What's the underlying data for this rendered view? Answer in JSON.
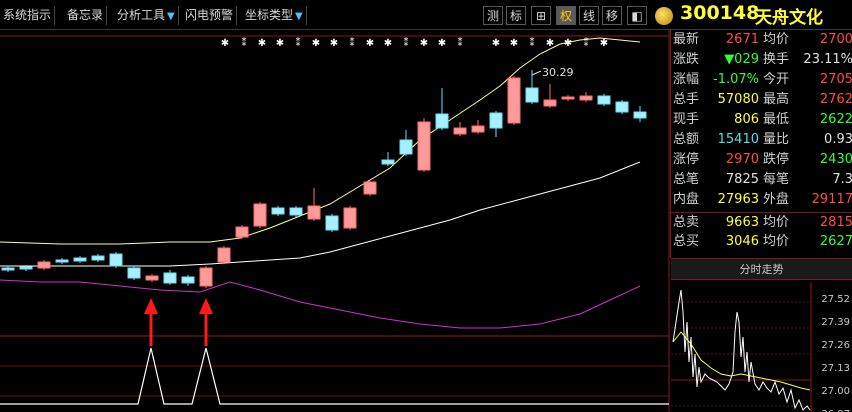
{
  "toolbar": {
    "items": [
      {
        "label": "系统指示",
        "arrow": false
      },
      {
        "label": "备忘录",
        "arrow": false
      },
      {
        "label": "分析工具",
        "arrow": true
      },
      {
        "label": "闪电预警",
        "arrow": false
      },
      {
        "label": "坐标类型",
        "arrow": true
      }
    ],
    "right_buttons": [
      {
        "label": "测",
        "active": false
      },
      {
        "label": "标",
        "active": false
      },
      {
        "label": "⊞",
        "active": false
      },
      {
        "label": "权",
        "active": true
      },
      {
        "label": "线",
        "active": false
      },
      {
        "label": "移",
        "active": false
      },
      {
        "label": "◧",
        "active": false
      }
    ],
    "stock_code": "300148",
    "stock_name": "天舟文化"
  },
  "chart": {
    "high_label": "30.29",
    "colors": {
      "up": "#ff6b6b",
      "down": "#66e0ff",
      "ma_short": "#ffff99",
      "ma_long": "#ffffff",
      "ma_indicator": "#cc33cc",
      "grid": "#8b1a1a",
      "arrow": "#ff1a1a"
    }
  },
  "quote": {
    "rows": [
      {
        "l1": "最新",
        "v1": "2671",
        "c1": "red",
        "l2": "均价",
        "v2": "2700",
        "c2": "red"
      },
      {
        "l1": "涨跌",
        "v1": "▼029",
        "c1": "green",
        "l2": "换手",
        "v2": "23.11%",
        "c2": "white"
      },
      {
        "l1": "涨幅",
        "v1": "-1.07%",
        "c1": "green",
        "l2": "今开",
        "v2": "2705",
        "c2": "red"
      },
      {
        "l1": "总手",
        "v1": "57080",
        "c1": "yellow",
        "l2": "最高",
        "v2": "2762",
        "c2": "red"
      },
      {
        "l1": "现手",
        "v1": "806",
        "c1": "yellow",
        "l2": "最低",
        "v2": "2622",
        "c2": "green"
      },
      {
        "l1": "总额",
        "v1": "15410",
        "c1": "cyan",
        "l2": "量比",
        "v2": "0.93",
        "c2": "white"
      },
      {
        "l1": "涨停",
        "v1": "2970",
        "c1": "red",
        "l2": "跌停",
        "v2": "2430",
        "c2": "green"
      },
      {
        "l1": "总笔",
        "v1": "7825",
        "c1": "white",
        "l2": "每笔",
        "v2": "7.3",
        "c2": "white"
      },
      {
        "l1": "内盘",
        "v1": "27963",
        "c1": "yellow",
        "l2": "外盘",
        "v2": "29117",
        "c2": "red"
      },
      {
        "l1": "总卖",
        "v1": "9663",
        "c1": "yellow",
        "l2": "均价",
        "v2": "2815",
        "c2": "red"
      },
      {
        "l1": "总买",
        "v1": "3046",
        "c1": "yellow",
        "l2": "均价",
        "v2": "2627",
        "c2": "green"
      }
    ]
  },
  "intraday": {
    "title": "分时走势",
    "ticks": [
      "27.52",
      "27.39",
      "27.26",
      "27.13",
      "27.00",
      "26.87"
    ]
  }
}
